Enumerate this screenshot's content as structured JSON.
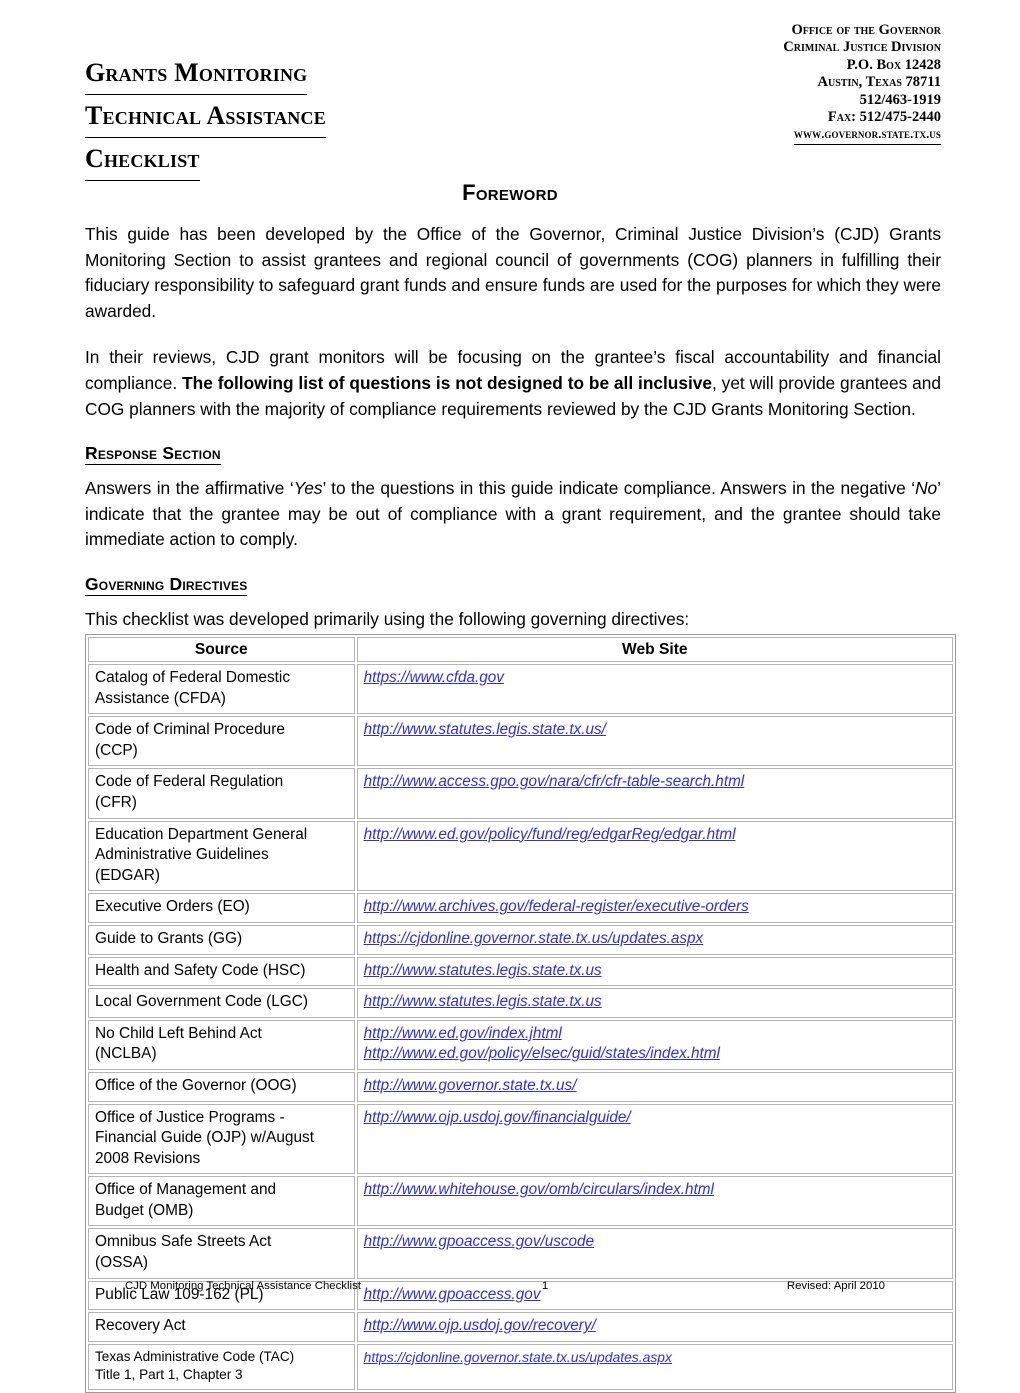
{
  "header": {
    "title_lines": [
      "Grants Monitoring",
      "Technical Assistance",
      "Checklist"
    ],
    "agency_lines": [
      "Office of the Governor",
      "Criminal Justice Division",
      "P.O. Box 12428",
      "Austin, Texas 78711",
      "512/463-1919",
      "Fax: 512/475-2440"
    ],
    "agency_website": "www.governor.state.tx.us"
  },
  "foreword": {
    "heading": "Foreword",
    "paragraph1": "This guide has been developed by the Office of the Governor, Criminal Justice Division’s (CJD) Grants Monitoring Section to assist grantees and regional council of governments (COG) planners in fulfilling their fiduciary responsibility to safeguard grant funds and ensure funds are used for the purposes for which they were awarded.",
    "paragraph2_part1": "In their reviews, CJD grant monitors will be focusing on the grantee’s fiscal accountability and financial compliance.  ",
    "paragraph2_bold": "The following list of questions is not designed to be all inclusive",
    "paragraph2_part2": ", yet will provide grantees and COG planners with the majority of compliance requirements reviewed by the CJD Grants Monitoring Section."
  },
  "response_section": {
    "heading": "Response Section",
    "text_part1": "Answers in the affirmative ‘",
    "yes_word": "Yes",
    "text_part2": "’ to the questions in this guide indicate compliance.  Answers in the negative ‘",
    "no_word": "No",
    "text_part3": "’ indicate that the grantee may be out of compliance with a grant requirement, and the grantee should take immediate action to comply."
  },
  "governing_directives": {
    "heading": "Governing Directives",
    "intro": "This checklist was developed primarily using the following governing directives:",
    "table": {
      "columns": [
        "Source",
        "Web Site"
      ],
      "rows": [
        {
          "source": "Catalog of Federal Domestic\nAssistance (CFDA)",
          "links": [
            "https://www.cfda.gov"
          ]
        },
        {
          "source": "Code of Criminal Procedure\n(CCP)",
          "links": [
            "http://www.statutes.legis.state.tx.us/"
          ]
        },
        {
          "source": "Code of Federal Regulation\n(CFR)",
          "links": [
            "http://www.access.gpo.gov/nara/cfr/cfr-table-search.html"
          ]
        },
        {
          "source": "Education Department General\nAdministrative Guidelines\n(EDGAR)",
          "links": [
            "http://www.ed.gov/policy/fund/reg/edgarReg/edgar.html"
          ]
        },
        {
          "source": "Executive Orders (EO)",
          "links": [
            "http://www.archives.gov/federal-register/executive-orders"
          ]
        },
        {
          "source": "Guide to Grants (GG)",
          "links": [
            "https://cjdonline.governor.state.tx.us/updates.aspx"
          ]
        },
        {
          "source": "Health and Safety Code (HSC)",
          "links": [
            "http://www.statutes.legis.state.tx.us "
          ]
        },
        {
          "source": "Local Government Code (LGC)",
          "links": [
            "http://www.statutes.legis.state.tx.us "
          ]
        },
        {
          "source": "No Child Left Behind Act\n(NCLBA)",
          "links": [
            "http://www.ed.gov/index.jhtml",
            "http://www.ed.gov/policy/elsec/guid/states/index.html"
          ]
        },
        {
          "source": "Office of the Governor (OOG)",
          "links": [
            "http://www.governor.state.tx.us/"
          ]
        },
        {
          "source": "Office of Justice Programs -\nFinancial Guide (OJP) w/August\n2008 Revisions",
          "links": [
            "http://www.ojp.usdoj.gov/financialguide/"
          ]
        },
        {
          "source": "Office of Management and\nBudget (OMB)",
          "links": [
            "http://www.whitehouse.gov/omb/circulars/index.html"
          ]
        },
        {
          "source": "Omnibus Safe Streets Act\n(OSSA)",
          "links": [
            "http://www.gpoaccess.gov/uscode"
          ]
        },
        {
          "source": "Public Law 109-162 (PL)",
          "links": [
            "http://www.gpoaccess.gov"
          ]
        },
        {
          "source": "Recovery Act",
          "links": [
            "http://www.ojp.usdoj.gov/recovery/"
          ]
        },
        {
          "source": "Texas Administrative Code (TAC)\nTitle 1, Part 1, Chapter 3",
          "links": [
            "https://cjdonline.governor.state.tx.us/updates.aspx"
          ],
          "small": true
        }
      ]
    }
  },
  "footer": {
    "left": "CJD Monitoring Technical Assistance Checklist",
    "page_number": "1",
    "right": "Revised: April 2010"
  },
  "colors": {
    "link": "#3232cc",
    "text": "#000000",
    "table_border": "#b5b5b5"
  }
}
